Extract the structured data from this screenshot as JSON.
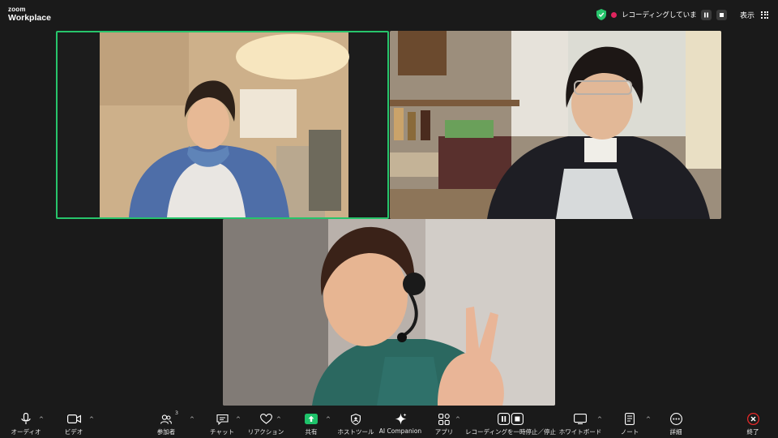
{
  "app": {
    "brand_small": "zoom",
    "brand_main": "Workplace"
  },
  "header": {
    "recording_status": "レコーディングしています...",
    "view_label": "表示"
  },
  "participants": [
    {
      "tile": "upper-left",
      "active_speaker": true
    },
    {
      "tile": "upper-right",
      "active_speaker": false
    },
    {
      "tile": "bottom-center",
      "active_speaker": false
    }
  ],
  "toolbar": {
    "audio": "オーディオ",
    "video": "ビデオ",
    "participants": "参加者",
    "participant_count": "3",
    "chat": "チャット",
    "reactions": "リアクション",
    "share": "共有",
    "host_tools": "ホストツール",
    "ai_companion": "AI Companion",
    "apps": "アプリ",
    "recording": "レコーディングを一時停止／停止",
    "whiteboard": "ホワイトボード",
    "notes": "ノート",
    "more": "詳細",
    "end": "終了"
  },
  "colors": {
    "active_border": "#27c46b",
    "share_green": "#1ec26a",
    "end_red": "#e02828",
    "recording_red": "#e0245e"
  }
}
